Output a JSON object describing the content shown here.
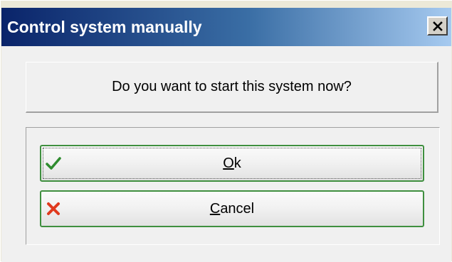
{
  "window": {
    "title": "Control system manually",
    "close_glyph": "✕"
  },
  "dialog": {
    "question": "Do you want to start this system now?"
  },
  "buttons": {
    "ok": {
      "mnemonic": "O",
      "rest": "k",
      "icon": "check-icon",
      "icon_color": "#2e8b2e",
      "focused": true
    },
    "cancel": {
      "mnemonic": "C",
      "rest": "ancel",
      "icon": "cross-icon",
      "icon_color": "#e03a1e",
      "focused": false
    }
  },
  "colors": {
    "title_start": "#0a246a",
    "title_end": "#a6caf0",
    "button_border": "#3f8f3f"
  }
}
